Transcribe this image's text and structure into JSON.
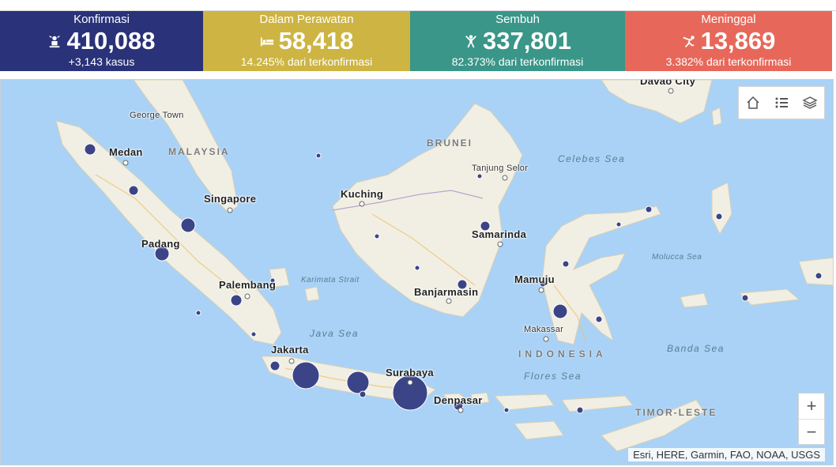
{
  "stats": [
    {
      "title": "Konfirmasi",
      "value": "410,088",
      "sub": "+3,143 kasus",
      "color": "#2a3279",
      "icon": "confirmed-person-icon"
    },
    {
      "title": "Dalam Perawatan",
      "value": "58,418",
      "sub": "14.245% dari terkonfirmasi",
      "color": "#cdb443",
      "icon": "hospital-bed-icon"
    },
    {
      "title": "Sembuh",
      "value": "337,801",
      "sub": "82.373% dari terkonfirmasi",
      "color": "#3a9688",
      "icon": "recovered-person-icon"
    },
    {
      "title": "Meninggal",
      "value": "13,869",
      "sub": "3.382% dari terkonfirmasi",
      "color": "#e7685a",
      "icon": "deceased-person-icon"
    }
  ],
  "map": {
    "cities": {
      "davao": "Davao City",
      "georgetown": "George Town",
      "medan": "Medan",
      "singapore": "Singapore",
      "padang": "Padang",
      "palembang": "Palembang",
      "jakarta": "Jakarta",
      "surabaya": "Surabaya",
      "denpasar": "Denpasar",
      "kuching": "Kuching",
      "samarinda": "Samarinda",
      "banjarmasin": "Banjarmasin",
      "tanjung": "Tanjung Selor",
      "mamuju": "Mamuju",
      "makassar": "Makassar"
    },
    "countries": {
      "malaysia": "MALAYSIA",
      "brunei": "BRUNEI",
      "indonesia": "INDONESIA",
      "timor": "TIMOR-LESTE"
    },
    "seas": {
      "celebes": "Celebes Sea",
      "molucca": "Molucca Sea",
      "karimata": "Karimata Strait",
      "java": "Java Sea",
      "flores": "Flores Sea",
      "banda": "Banda Sea"
    },
    "attribution": "Esri, HERE, Garmin, FAO, NOAA, USGS",
    "controls": {
      "zoom_in": "+",
      "zoom_out": "−"
    },
    "land_color": "#f1efe3",
    "water_color": "#a9d2f6",
    "bubble_color": "#3c4488"
  }
}
